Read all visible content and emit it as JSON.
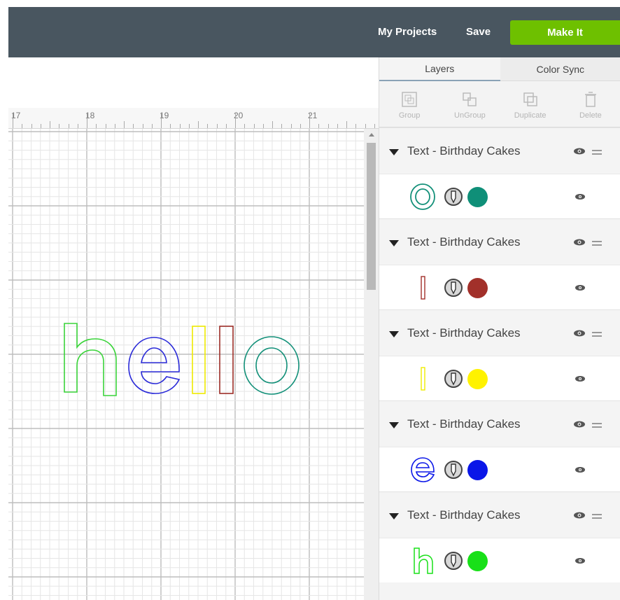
{
  "header": {
    "my_projects": "My Projects",
    "save": "Save",
    "make_it": "Make It",
    "colors": {
      "bar": "#495660",
      "make_it": "#6ec000"
    }
  },
  "ruler": {
    "labels": [
      "17",
      "18",
      "19",
      "20",
      "21"
    ]
  },
  "canvas": {
    "text": "hello"
  },
  "panel": {
    "tabs": [
      {
        "label": "Layers",
        "active": true
      },
      {
        "label": "Color Sync",
        "active": false
      }
    ],
    "tools": [
      {
        "label": "Group",
        "icon": "group-icon"
      },
      {
        "label": "UnGroup",
        "icon": "ungroup-icon"
      },
      {
        "label": "Duplicate",
        "icon": "duplicate-icon"
      },
      {
        "label": "Delete",
        "icon": "delete-icon"
      }
    ],
    "layers": [
      {
        "name": "Text - Birthday Cakes",
        "glyph": "o",
        "color": "#0f8f78"
      },
      {
        "name": "Text - Birthday Cakes",
        "glyph": "l",
        "color": "#a2302a"
      },
      {
        "name": "Text - Birthday Cakes",
        "glyph": "l",
        "color": "#fff200"
      },
      {
        "name": "Text - Birthday Cakes",
        "glyph": "e",
        "color": "#0a16e8"
      },
      {
        "name": "Text - Birthday Cakes",
        "glyph": "h",
        "color": "#18e018"
      }
    ]
  }
}
